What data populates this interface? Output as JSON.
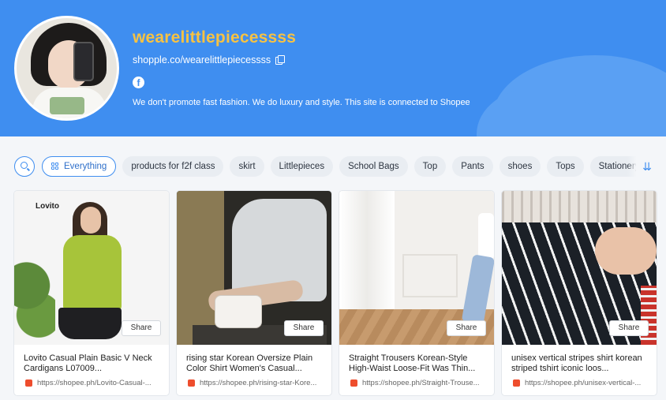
{
  "header": {
    "shop_name": "wearelittlepiecessss",
    "shop_link": "shopple.co/wearelittlepiecessss",
    "bio": "We don't promote fast fashion. We do luxury and style. This site is connected to Shopee",
    "social_icon": "facebook-icon",
    "accent_color": "#3f8ef0",
    "name_color": "#f6c243"
  },
  "filters": {
    "active": "Everything",
    "chips": [
      "products for f2f class",
      "skirt",
      "Littlepieces",
      "School Bags",
      "Top",
      "Pants",
      "shoes",
      "Tops",
      "Stationery"
    ],
    "expand_icon": "double-chevron-down-icon"
  },
  "products": [
    {
      "title": "Lovito Casual Plain Basic V Neck Cardigans L07009...",
      "url": "https://shopee.ph/Lovito-Casual-...",
      "share_label": "Share",
      "brand_overlay": "Lovito"
    },
    {
      "title": "rising star Korean Oversize Plain Color Shirt Women's Casual...",
      "url": "https://shopee.ph/rising-star-Kore...",
      "share_label": "Share"
    },
    {
      "title": "Straight Trousers Korean-Style High-Waist Loose-Fit Was Thin...",
      "url": "https://shopee.ph/Straight-Trouse...",
      "share_label": "Share"
    },
    {
      "title": "unisex vertical stripes shirt korean striped tshirt iconic loos...",
      "url": "https://shopee.ph/unisex-vertical-...",
      "share_label": "Share"
    }
  ]
}
